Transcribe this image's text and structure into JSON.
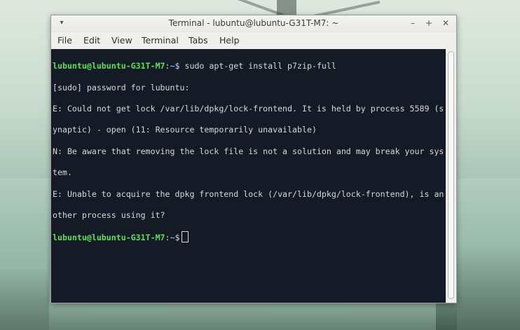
{
  "window": {
    "title": "Terminal - lubuntu@lubuntu-G31T-M7: ~",
    "menu_glyph": "▾",
    "controls": {
      "minimize": "–",
      "maximize": "+",
      "close": "✕"
    }
  },
  "menubar": {
    "items": [
      "File",
      "Edit",
      "View",
      "Terminal",
      "Tabs",
      "Help"
    ]
  },
  "terminal": {
    "prompt": {
      "user_host": "lubuntu@lubuntu-G31T-M7",
      "sep": ":",
      "path": "~",
      "symbol": "$"
    },
    "command": " sudo apt-get install p7zip-full",
    "output": [
      "[sudo] password for lubuntu:",
      "E: Could not get lock /var/lib/dpkg/lock-frontend. It is held by process 5589 (s",
      "ynaptic) - open (11: Resource temporarily unavailable)",
      "N: Be aware that removing the lock file is not a solution and may break your sys",
      "tem.",
      "E: Unable to acquire the dpkg frontend lock (/var/lib/dpkg/lock-frontend), is an",
      "other process using it?"
    ],
    "colors": {
      "background": "#141a26",
      "text": "#d8d8d8",
      "user": "#5ee05a",
      "path": "#6ab0ff"
    }
  }
}
